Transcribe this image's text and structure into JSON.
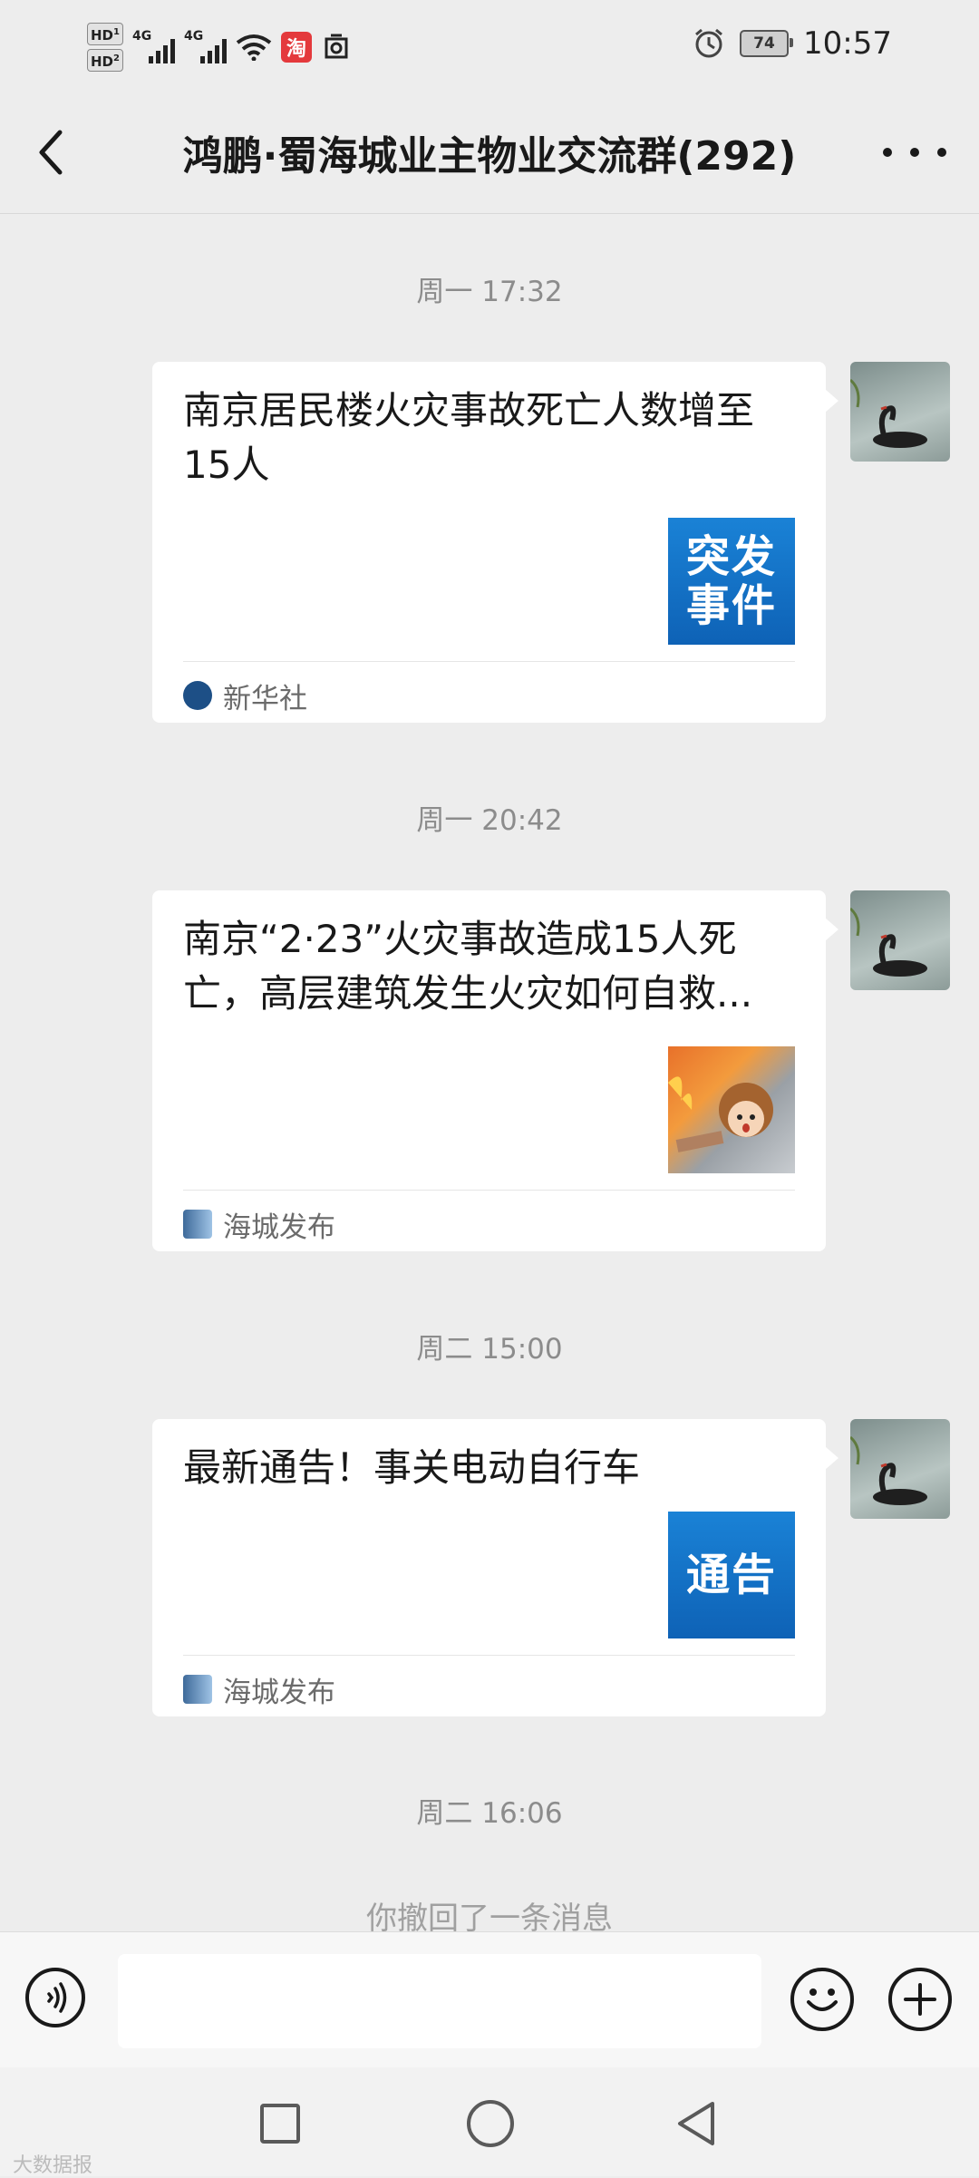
{
  "status_bar": {
    "hd1": "HD",
    "hd1_sub": "1",
    "hd2": "HD",
    "hd2_sub": "2",
    "net1": "4G",
    "net2": "4G",
    "taobao": "淘",
    "battery": "74",
    "time": "10:57"
  },
  "header": {
    "title": "鸿鹏·蜀海城业主物业交流群(292)"
  },
  "messages": [
    {
      "time": "周一 17:32",
      "title": "南京居民楼火灾事故死亡人数增至15人",
      "thumb_text": "突发\n事件",
      "source": "新华社"
    },
    {
      "time": "周一 20:42",
      "title": "南京“2·23”火灾事故造成15人死亡，高层建筑发生火灾如何自救...",
      "source": "海城发布"
    },
    {
      "time": "周二 15:00",
      "title": "最新通告！事关电动自行车",
      "thumb_text": "通告",
      "source": "海城发布"
    }
  ],
  "last_time": "周二 16:06",
  "recall_notice": "你撤回了一条消息",
  "input": {
    "value": ""
  },
  "watermark": "大数据报"
}
